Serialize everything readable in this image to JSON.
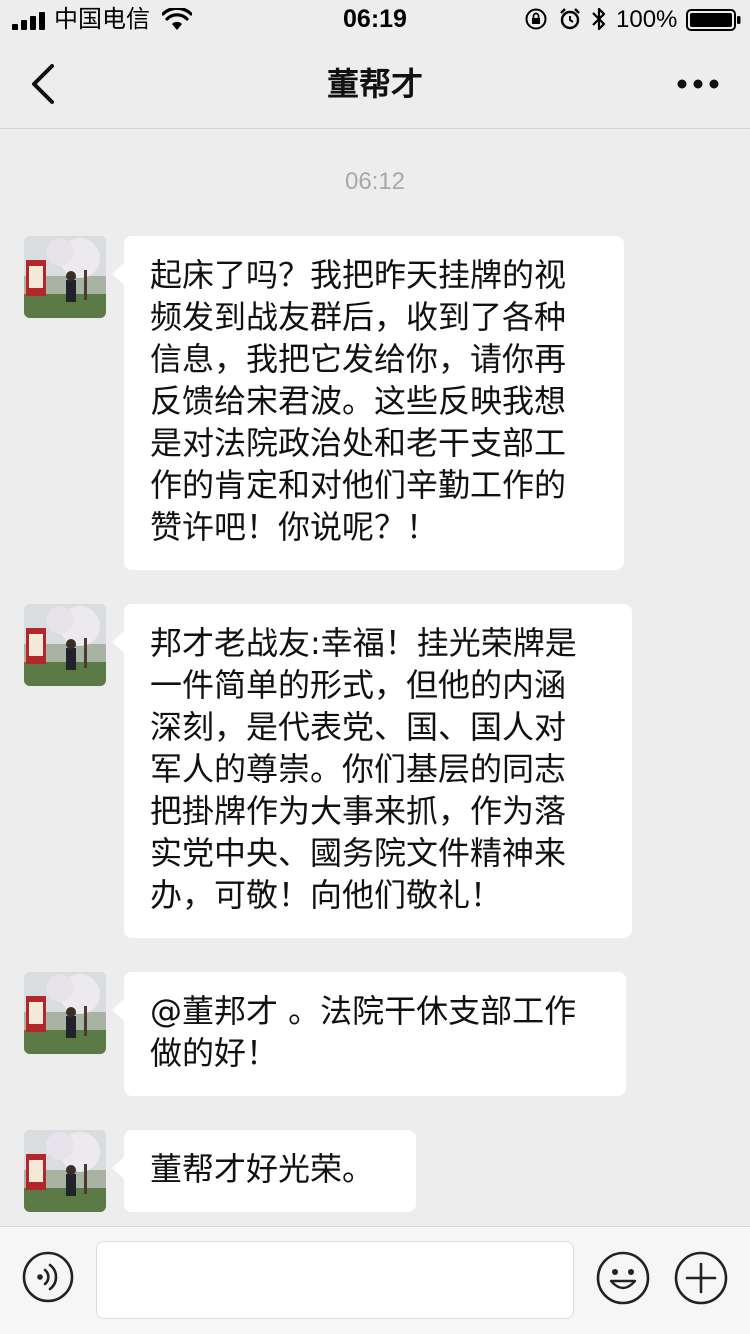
{
  "status_bar": {
    "carrier": "中国电信",
    "time": "06:19",
    "battery": "100%"
  },
  "nav": {
    "title": "董帮才",
    "back_icon": "chevron-left-icon",
    "more_icon": "more-dots-icon"
  },
  "chat": {
    "timestamp": "06:12",
    "messages": [
      {
        "sender": "contact",
        "text": "起床了吗？我把昨天挂牌的视\n频发到战友群后，收到了各种\n信息，我把它发给你，请你再\n反馈给宋君波。这些反映我想\n是对法院政治处和老干支部工\n作的肯定和对他们辛勤工作的\n赞许吧！你说呢？！"
      },
      {
        "sender": "contact",
        "text": "邦才老战友:幸福！挂光荣牌是\n一件简单的形式，但他的内涵\n深刻，是代表党、国、国人对\n军人的尊崇。你们基层的同志\n把掛牌作为大事来抓，作为落\n实党中央、國务院文件精神来\n办，可敬！向他们敬礼！"
      },
      {
        "sender": "contact",
        "text": "@董邦才 。法院干休支部工作\n做的好！"
      },
      {
        "sender": "contact",
        "text": "董帮才好光荣。"
      }
    ]
  },
  "input_bar": {
    "voice_icon": "voice-icon",
    "text_value": "",
    "emoji_icon": "emoji-icon",
    "plus_icon": "plus-icon"
  },
  "colors": {
    "background": "#ededed",
    "bubble": "#ffffff",
    "timestamp": "#a8a8a8"
  }
}
